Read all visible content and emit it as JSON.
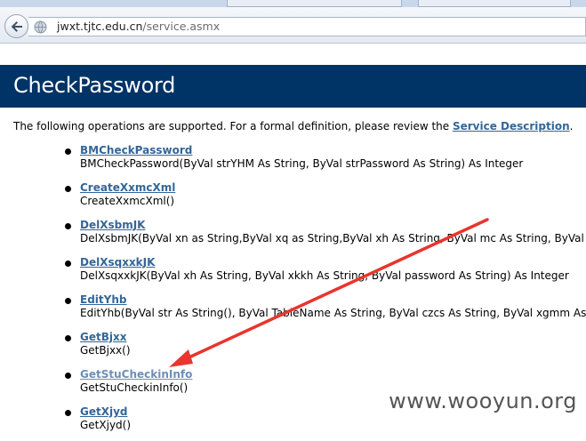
{
  "browser": {
    "url_host": "jwxt.tjtc.edu.cn",
    "url_path": "/service.asmx"
  },
  "page": {
    "title": "CheckPassword",
    "intro_text": "The following operations are supported. For a formal definition, please review the ",
    "intro_link": "Service Description",
    "intro_suffix": "."
  },
  "operations": [
    {
      "name": "BMCheckPassword",
      "signature": "BMCheckPassword(ByVal strYHM As String, ByVal strPassword As String) As Integer"
    },
    {
      "name": "CreateXxmcXml",
      "signature": "CreateXxmcXml()"
    },
    {
      "name": "DelXsbmJK",
      "signature": "DelXsbmJK(ByVal xn as String,ByVal xq as String,ByVal xh As String, ByVal mc As String, ByVal pa"
    },
    {
      "name": "DelXsqxxkJK",
      "signature": "DelXsqxxkJK(ByVal xh As String, ByVal xkkh As String, ByVal password As String) As Integer"
    },
    {
      "name": "EditYhb",
      "signature": "EditYhb(ByVal str As String(), ByVal TableName As String, ByVal czcs As String, ByVal xgmm As St"
    },
    {
      "name": "GetBjxx",
      "signature": "GetBjxx()"
    },
    {
      "name": "GetStuCheckinInfo",
      "signature": "GetStuCheckinInfo()"
    },
    {
      "name": "GetXjyd",
      "signature": "GetXjyd()"
    }
  ],
  "watermark": "www.wooyun.org",
  "colors": {
    "header_bg": "#003366",
    "link": "#336699",
    "arrow": "#e8352e"
  }
}
